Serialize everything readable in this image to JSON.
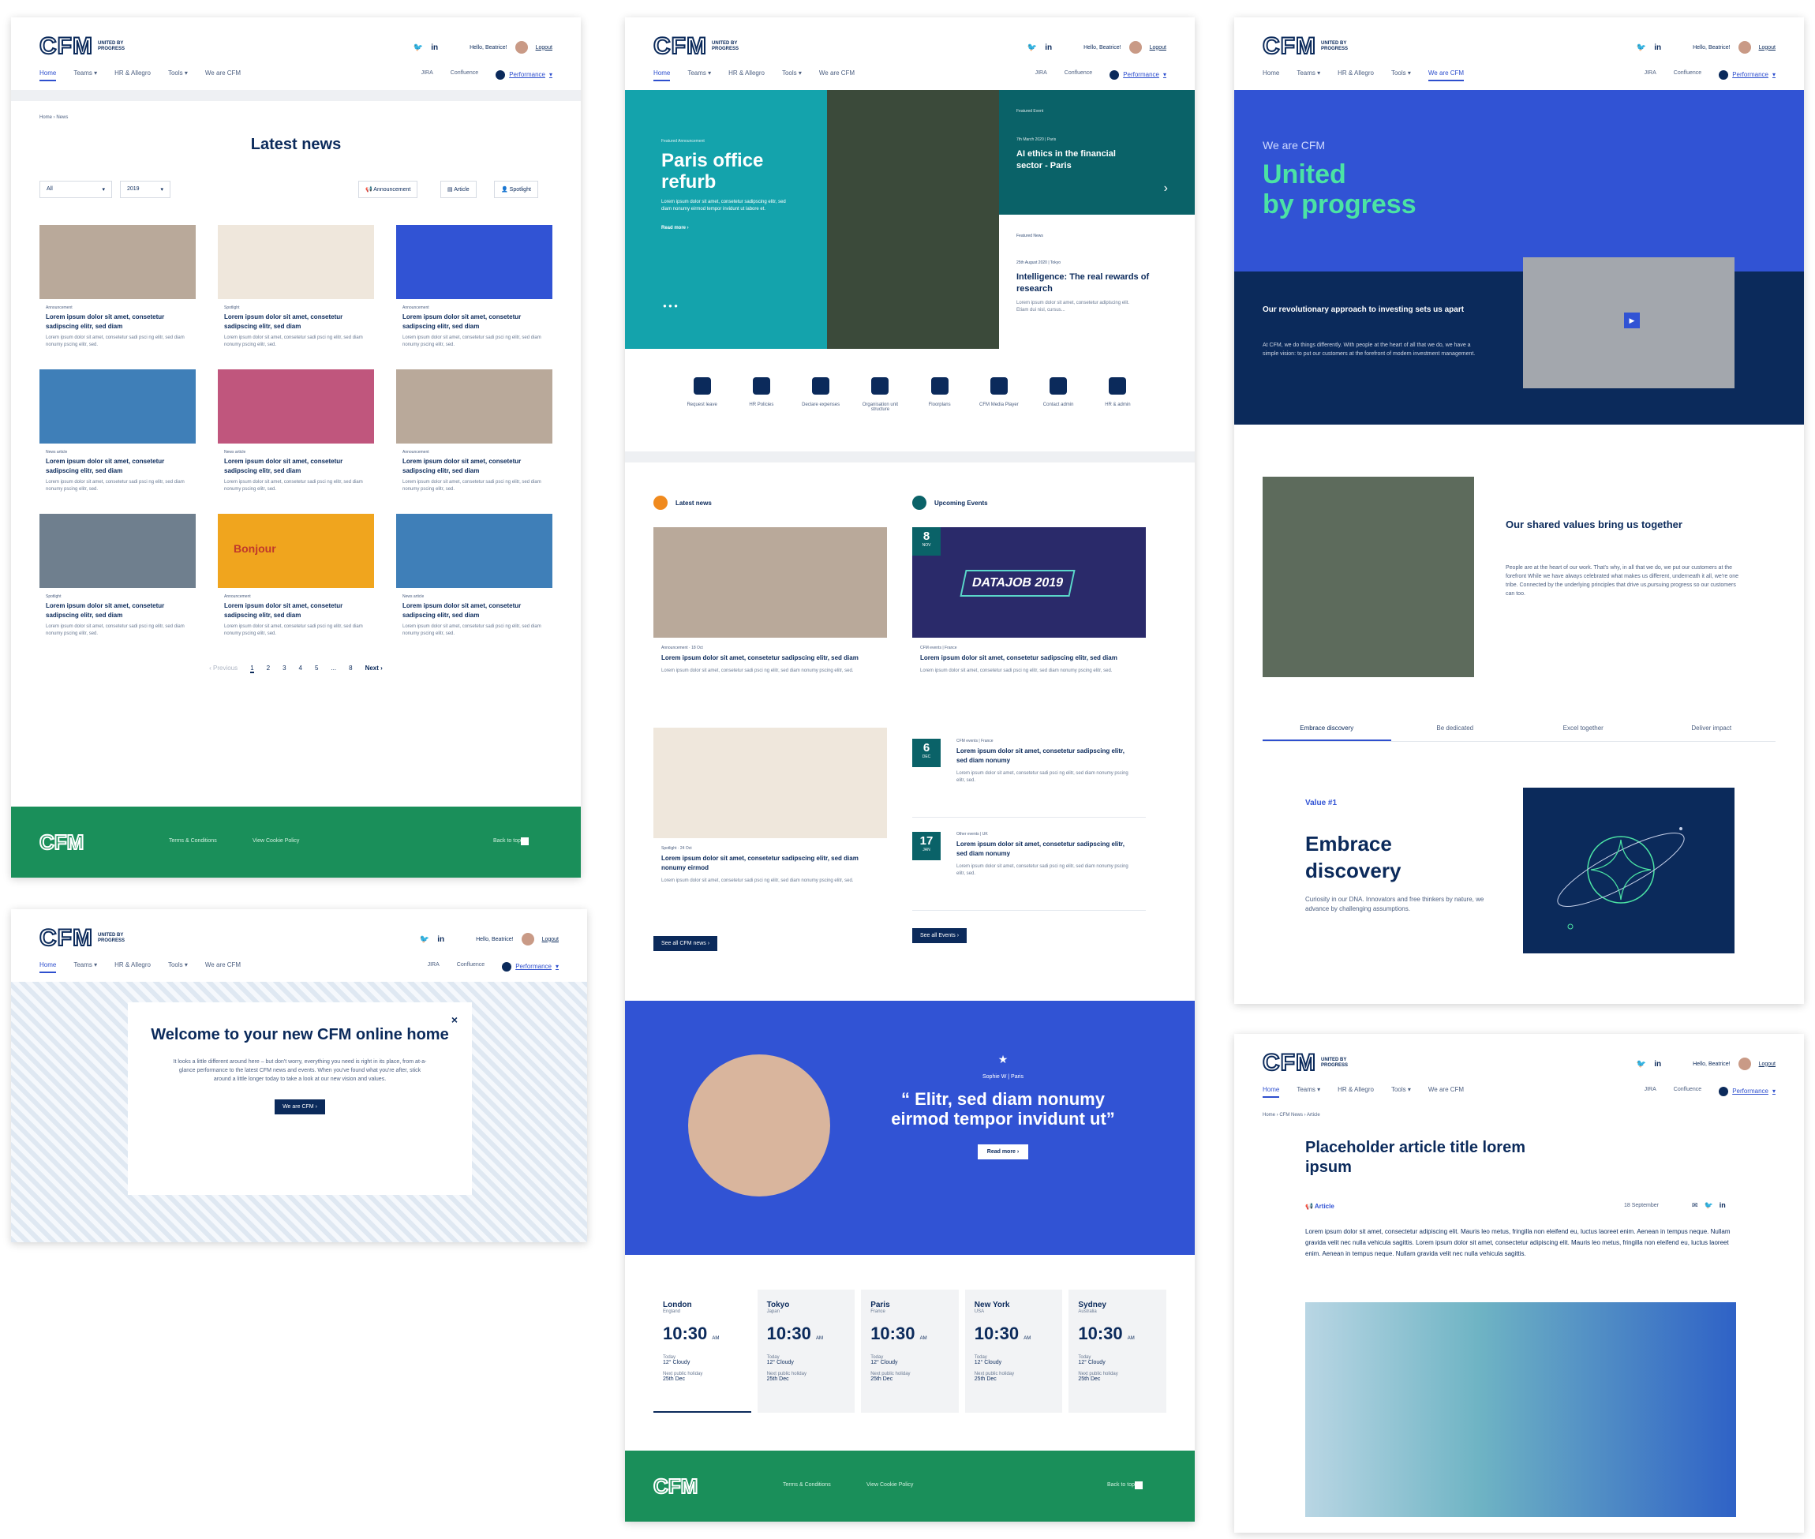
{
  "header": {
    "logo": "CFM",
    "tagline": "United by progress",
    "greeting": "Hello, Beatrice!",
    "logout": "Logout",
    "twitter": "🐦",
    "linkedin": "in",
    "nav": [
      "Home",
      "Teams ▾",
      "HR & Allegro",
      "Tools ▾",
      "We are CFM"
    ],
    "nav_right": [
      "JIRA",
      "Confluence"
    ],
    "performance": "Performance"
  },
  "news_page": {
    "breadcrumb": "Home › News",
    "title": "Latest news",
    "filter_all": "All",
    "filter_year": "2019",
    "filter_buttons": [
      "Announcement",
      "Article",
      "Spotlight"
    ],
    "cards": [
      {
        "label": "Announcement",
        "title": "Lorem ipsum dolor sit amet, consetetur sadipscing elitr, sed diam",
        "desc": "Lorem ipsum dolor sit amet, consetetur sadi psci ng elitr, sed diam nonumy pscing elitr, sed.",
        "color": "#b9a99a"
      },
      {
        "label": "Spotlight",
        "title": "Lorem ipsum dolor sit amet, consetetur sadipscing elitr, sed diam",
        "desc": "Lorem ipsum dolor sit amet, consetetur sadi psci ng elitr, sed diam nonumy pscing elitr, sed.",
        "color": "#efe7dc"
      },
      {
        "label": "Announcement",
        "title": "Lorem ipsum dolor sit amet, consetetur sadipscing elitr, sed diam",
        "desc": "Lorem ipsum dolor sit amet, consetetur sadi psci ng elitr, sed diam nonumy pscing elitr, sed.",
        "color": "#3153d4"
      },
      {
        "label": "News article",
        "title": "Lorem ipsum dolor sit amet, consetetur sadipscing elitr, sed diam",
        "desc": "Lorem ipsum dolor sit amet, consetetur sadi psci ng elitr, sed diam nonumy pscing elitr, sed.",
        "color": "#3f7fb8"
      },
      {
        "label": "News article",
        "title": "Lorem ipsum dolor sit amet, consetetur sadipscing elitr, sed diam",
        "desc": "Lorem ipsum dolor sit amet, consetetur sadi psci ng elitr, sed diam nonumy pscing elitr, sed.",
        "color": "#c0567d"
      },
      {
        "label": "Announcement",
        "title": "Lorem ipsum dolor sit amet, consetetur sadipscing elitr, sed diam",
        "desc": "Lorem ipsum dolor sit amet, consetetur sadi psci ng elitr, sed diam nonumy pscing elitr, sed.",
        "color": "#b9a99a"
      },
      {
        "label": "Spotlight",
        "title": "Lorem ipsum dolor sit amet, consetetur sadipscing elitr, sed diam",
        "desc": "Lorem ipsum dolor sit amet, consetetur sadi psci ng elitr, sed diam nonumy pscing elitr, sed.",
        "color": "#6f7f8e"
      },
      {
        "label": "Announcement",
        "title": "Lorem ipsum dolor sit amet, consetetur sadipscing elitr, sed diam",
        "desc": "Lorem ipsum dolor sit amet, consetetur sadi psci ng elitr, sed diam nonumy pscing elitr, sed.",
        "color": "#f0a51e",
        "overlay": "Bonjour"
      },
      {
        "label": "News article",
        "title": "Lorem ipsum dolor sit amet, consetetur sadipscing elitr, sed diam",
        "desc": "Lorem ipsum dolor sit amet, consetetur sadi psci ng elitr, sed diam nonumy pscing elitr, sed.",
        "color": "#3f7fb8"
      }
    ],
    "pager": {
      "prev": "‹ Previous",
      "pages": [
        "1",
        "2",
        "3",
        "4",
        "5",
        "...",
        "8"
      ],
      "next": "Next ›"
    }
  },
  "footer": {
    "terms": "Terms & Conditions",
    "cookie": "View Cookie Policy",
    "back": "Back to top"
  },
  "welcome": {
    "title": "Welcome to your new CFM online home",
    "body": "It looks a little different around here – but don't worry, everything you need is right in its place, from at-a-glance performance to the latest CFM news and events. When you've found what you're after, stick around a little longer today to take a look at our new vision and values.",
    "button": "We are CFM ›",
    "close": "×"
  },
  "home": {
    "hero_eyebrow": "Featured Announcement",
    "hero_title": "Paris office refurb",
    "hero_body": "Lorem ipsum dolor sit amet, consetetur sadipscing elitr, sed diam nonumy eirmod tempor invidunt ut labore et.",
    "hero_more": "Read more ›",
    "feat1_eyebrow": "Featured Event",
    "feat1_date": "7th March 2020 | Paris",
    "feat1_title": "AI ethics in the financial sector - Paris",
    "feat2_eyebrow": "Featured News",
    "feat2_date": "25th August 2020 | Tokyo",
    "feat2_title": "Intelligence: The real rewards of research",
    "feat2_body": "Lorem ipsum dolor sit amet, consetetur adipiscing elit. Etiam dui nisl, cursus...",
    "quick": [
      "Request leave",
      "HR Policies",
      "Declare expenses",
      "Organisation unit structure",
      "Floorplans",
      "CFM Media Player",
      "Contact admin",
      "HR & admin"
    ],
    "latest_title": "Latest news",
    "events_title": "Upcoming Events",
    "news_items": [
      {
        "label": "Announcement · 18 Oct",
        "title": "Lorem ipsum dolor sit amet, consetetur sadipscing elitr, sed diam",
        "desc": "Lorem ipsum dolor sit amet, consetetur sadi psci ng elitr, sed diam nonumy pscing elitr, sed.",
        "color": "#b9a99a"
      },
      {
        "label": "Spotlight · 24 Oct",
        "title": "Lorem ipsum dolor sit amet, consetetur sadipscing elitr, sed diam nonumy eirmod",
        "desc": "Lorem ipsum dolor sit amet, consetetur sadi psci ng elitr, sed diam nonumy pscing elitr, sed.",
        "color": "#efe7dc"
      }
    ],
    "datajob": "DATAJOB 2019",
    "datajob_date": {
      "day": "8",
      "month": "NOV"
    },
    "datajob_label": "CFM events | France",
    "datajob_title": "Lorem ipsum dolor sit amet, consetetur sadipscing elitr, sed diam",
    "datajob_desc": "Lorem ipsum dolor sit amet, consetetur sadi psci ng elitr, sed diam nonumy pscing elitr, sed.",
    "events": [
      {
        "day": "6",
        "month": "DEC",
        "label": "CFM events | France",
        "title": "Lorem ipsum dolor sit amet, consetetur sadipscing elitr, sed diam nonumy",
        "desc": "Lorem ipsum dolor sit amet, consetetur sadi psci ng elitr, sed diam nonumy pscing elitr, sed."
      },
      {
        "day": "17",
        "month": "JAN",
        "label": "Other events | UK",
        "title": "Lorem ipsum dolor sit amet, consetetur sadipscing elitr, sed diam nonumy",
        "desc": "Lorem ipsum dolor sit amet, consetetur sadi psci ng elitr, sed diam nonumy pscing elitr, sed."
      }
    ],
    "see_news": "See all CFM news ›",
    "see_events": "See all Events ›",
    "quote_author": "Sophie W | Paris",
    "quote": "“ Elitr, sed diam nonumy eirmod tempor invidunt ut”",
    "quote_btn": "Read more ›",
    "clocks": [
      {
        "city": "London",
        "country": "England",
        "time": "10:30",
        "ampm": "AM",
        "today": "Today",
        "weather": "12° Cloudy",
        "holiday_label": "Next public holiday",
        "holiday": "25th Dec"
      },
      {
        "city": "Tokyo",
        "country": "Japan",
        "time": "10:30",
        "ampm": "AM",
        "today": "Today",
        "weather": "12° Cloudy",
        "holiday_label": "Next public holiday",
        "holiday": "25th Dec"
      },
      {
        "city": "Paris",
        "country": "France",
        "time": "10:30",
        "ampm": "AM",
        "today": "Today",
        "weather": "12° Cloudy",
        "holiday_label": "Next public holiday",
        "holiday": "25th Dec"
      },
      {
        "city": "New York",
        "country": "USA",
        "time": "10:30",
        "ampm": "AM",
        "today": "Today",
        "weather": "12° Cloudy",
        "holiday_label": "Next public holiday",
        "holiday": "25th Dec"
      },
      {
        "city": "Sydney",
        "country": "Australia",
        "time": "10:30",
        "ampm": "AM",
        "today": "Today",
        "weather": "12° Cloudy",
        "holiday_label": "Next public holiday",
        "holiday": "25th Dec"
      }
    ]
  },
  "about": {
    "eyebrow": "We are CFM",
    "title_1": "United",
    "title_2": "by progress",
    "band_title": "Our revolutionary approach to investing sets us apart",
    "band_body": "At CFM, we do things differently. With people at the heart of all that we do, we have a simple vision: to put our customers at the forefront of modern investment management.",
    "values_title": "Our shared values bring us together",
    "values_body": "People are at the heart of our work. That's why, in all that we do, we put our customers at the forefront While we have always celebrated what makes us different, underneath it all, we're one tribe. Connected by the underlying principles that drive us,pursuing progress so our customers can too.",
    "tabs": [
      "Embrace discovery",
      "Be dedicated",
      "Excel together",
      "Deliver impact"
    ],
    "value_label": "Value #1",
    "value_title": "Embrace discovery",
    "value_body": "Curiosity in our DNA. Innovators and free thinkers by nature, we advance by challenging assumptions."
  },
  "article": {
    "breadcrumb": "Home › CFM News › Article",
    "title": "Placeholder article title lorem ipsum",
    "type": "Article",
    "date": "18 September",
    "body": "Lorem ipsum dolor sit amet, consectetur adipiscing elit. Mauris leo metus, fringilla non eleifend eu, luctus laoreet enim. Aenean in tempus neque. Nullam gravida velit nec nulla vehicula sagittis. Lorem ipsum dolor sit amet, consectetur adipiscing elit. Mauris leo metus, fringilla non eleifend eu, luctus laoreet enim. Aenean in tempus neque. Nullam gravida velit nec nulla vehicula sagittis."
  }
}
